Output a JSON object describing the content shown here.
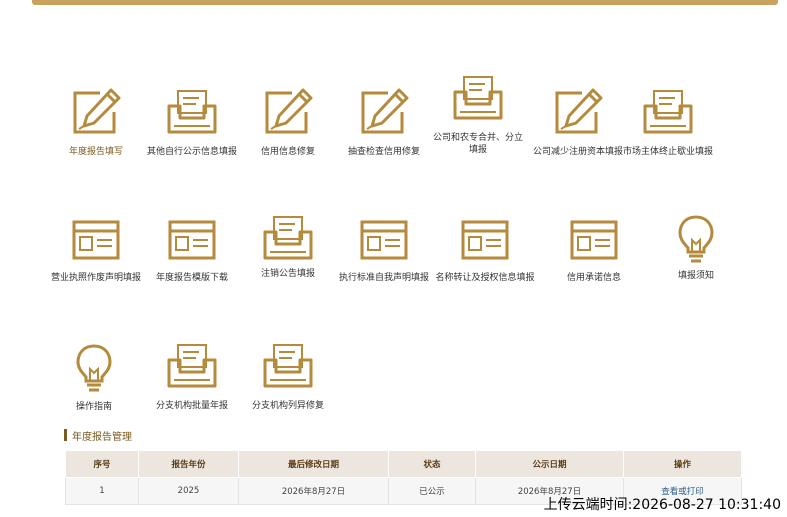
{
  "tiles": [
    {
      "label": "年度报告填写",
      "icon": "edit-document-icon"
    },
    {
      "label": "其他自行公示信息填报",
      "icon": "inbox-tray-icon"
    },
    {
      "label": "信用信息修复",
      "icon": "edit-document-icon"
    },
    {
      "label": "抽查检查信用修复",
      "icon": "edit-document-icon"
    },
    {
      "label": "公司和农专合并、分立填报",
      "icon": "inbox-tray-icon"
    },
    {
      "label": "公司减少注册资本填报",
      "icon": "edit-document-icon"
    },
    {
      "label": "市场主体终止歇业填报",
      "icon": "inbox-tray-icon"
    },
    {
      "label": "营业执照作废声明填报",
      "icon": "form-window-icon"
    },
    {
      "label": "年度报告模版下载",
      "icon": "form-window-icon"
    },
    {
      "label": "注销公告填报",
      "icon": "inbox-tray-icon"
    },
    {
      "label": "执行标准自我声明填报",
      "icon": "form-window-icon"
    },
    {
      "label": "名称转让及授权信息填报",
      "icon": "form-window-icon"
    },
    {
      "label": "信用承诺信息",
      "icon": "form-window-icon"
    },
    {
      "label": "填报须知",
      "icon": "lightbulb-icon"
    },
    {
      "label": "操作指南",
      "icon": "lightbulb-icon"
    },
    {
      "label": "分支机构批量年报",
      "icon": "inbox-tray-icon"
    },
    {
      "label": "分支机构列异修复",
      "icon": "inbox-tray-icon"
    }
  ],
  "section": {
    "title": "年度报告管理"
  },
  "table": {
    "headers": [
      "序号",
      "报告年份",
      "最后修改日期",
      "状态",
      "公示日期",
      "操作"
    ],
    "rows": [
      [
        "1",
        "2025",
        "2026年8月27日",
        "已公示",
        "2026年8月27日",
        "查看或打印"
      ]
    ]
  },
  "watermark": {
    "text": "上传云端时间:2026-08-27 10:31:40"
  },
  "colors": {
    "accent": "#c9a35e",
    "accent_dark": "#7a5a1f",
    "header_bg": "#ece6df",
    "link": "#2f5d8c"
  }
}
